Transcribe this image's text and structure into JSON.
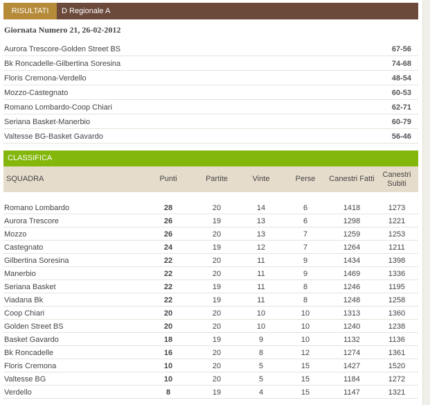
{
  "header": {
    "tab_label": "RISULTATI",
    "league": "D Regionale A"
  },
  "round": {
    "title": "Giornata Numero 21, 26-02-2012"
  },
  "results": [
    {
      "match": "Aurora Trescore-Golden Street BS",
      "score": "67-56"
    },
    {
      "match": "Bk Roncadelle-Gilbertina Soresina",
      "score": "74-68"
    },
    {
      "match": "Floris Cremona-Verdello",
      "score": "48-54"
    },
    {
      "match": "Mozzo-Castegnato",
      "score": "60-53"
    },
    {
      "match": "Romano Lombardo-Coop Chiari",
      "score": "62-71"
    },
    {
      "match": "Seriana Basket-Manerbio",
      "score": "60-79"
    },
    {
      "match": "Valtesse BG-Basket Gavardo",
      "score": "56-46"
    }
  ],
  "standings": {
    "title": "CLASSIFICA",
    "headers": {
      "team": "SQUADRA",
      "points": "Punti",
      "games": "Partite",
      "wins": "Vinte",
      "losses": "Perse",
      "scored": "Canestri Fatti",
      "against": "Canestri Subiti"
    },
    "rows": [
      {
        "team": "Romano Lombardo",
        "points": "28",
        "games": "20",
        "wins": "14",
        "losses": "6",
        "scored": "1418",
        "against": "1273"
      },
      {
        "team": "Aurora Trescore",
        "points": "26",
        "games": "19",
        "wins": "13",
        "losses": "6",
        "scored": "1298",
        "against": "1221"
      },
      {
        "team": "Mozzo",
        "points": "26",
        "games": "20",
        "wins": "13",
        "losses": "7",
        "scored": "1259",
        "against": "1253"
      },
      {
        "team": "Castegnato",
        "points": "24",
        "games": "19",
        "wins": "12",
        "losses": "7",
        "scored": "1264",
        "against": "1211"
      },
      {
        "team": "Gilbertina Soresina",
        "points": "22",
        "games": "20",
        "wins": "11",
        "losses": "9",
        "scored": "1434",
        "against": "1398"
      },
      {
        "team": "Manerbio",
        "points": "22",
        "games": "20",
        "wins": "11",
        "losses": "9",
        "scored": "1469",
        "against": "1336"
      },
      {
        "team": "Seriana Basket",
        "points": "22",
        "games": "19",
        "wins": "11",
        "losses": "8",
        "scored": "1246",
        "against": "1195"
      },
      {
        "team": "Viadana Bk",
        "points": "22",
        "games": "19",
        "wins": "11",
        "losses": "8",
        "scored": "1248",
        "against": "1258"
      },
      {
        "team": "Coop Chiari",
        "points": "20",
        "games": "20",
        "wins": "10",
        "losses": "10",
        "scored": "1313",
        "against": "1360"
      },
      {
        "team": "Golden Street BS",
        "points": "20",
        "games": "20",
        "wins": "10",
        "losses": "10",
        "scored": "1240",
        "against": "1238"
      },
      {
        "team": "Basket Gavardo",
        "points": "18",
        "games": "19",
        "wins": "9",
        "losses": "10",
        "scored": "1132",
        "against": "1136"
      },
      {
        "team": "Bk Roncadelle",
        "points": "16",
        "games": "20",
        "wins": "8",
        "losses": "12",
        "scored": "1274",
        "against": "1361"
      },
      {
        "team": "Floris Cremona",
        "points": "10",
        "games": "20",
        "wins": "5",
        "losses": "15",
        "scored": "1427",
        "against": "1520"
      },
      {
        "team": "Valtesse BG",
        "points": "10",
        "games": "20",
        "wins": "5",
        "losses": "15",
        "scored": "1184",
        "against": "1272"
      },
      {
        "team": "Verdello",
        "points": "8",
        "games": "19",
        "wins": "4",
        "losses": "15",
        "scored": "1147",
        "against": "1321"
      }
    ]
  },
  "colors": {
    "header_bar": "#6b4a3c",
    "tab_active": "#b58a38",
    "standings_bar": "#84b70c",
    "table_header": "#e6dccb"
  }
}
